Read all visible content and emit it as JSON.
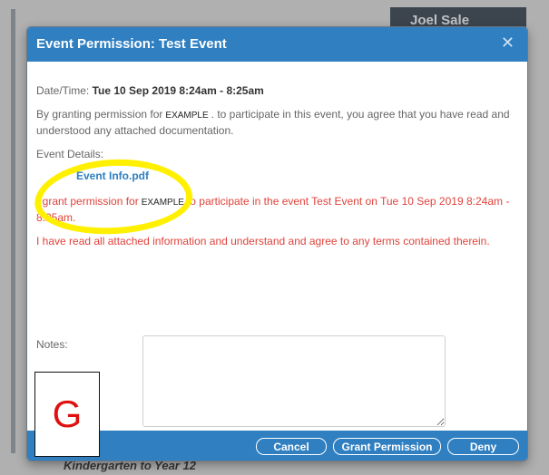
{
  "background": {
    "header_name": "Joel Sale",
    "bottom_text": "Kindergarten to Year 12"
  },
  "dialog": {
    "title": "Event Permission: Test Event",
    "close_icon": "close-icon",
    "datetime_label": "Date/Time:",
    "datetime_value": "Tue 10 Sep 2019 8:24am - 8:25am",
    "intro_part1": "By granting permission for",
    "intro_example": "EXAMPLE",
    "intro_part2": ". to participate in this event, you agree that you have read and understood any attached documentation.",
    "event_details_label": "Event Details:",
    "attachment_link": "Event Info.pdf",
    "grant_part1": "I grant permission for",
    "grant_example": "EXAMPLE",
    "grant_part2": "to participate in the event Test Event on Tue 10 Sep 2019 8:24am - 8:25am.",
    "terms_text": "I have read all attached information and understand and agree to any terms contained therein.",
    "notes_label": "Notes:",
    "notes_value": "",
    "buttons": {
      "cancel": "Cancel",
      "grant": "Grant Permission",
      "deny": "Deny"
    }
  },
  "overlay": {
    "letter": "G",
    "highlight_color": "#fff000",
    "letter_color": "#e01010"
  },
  "colors": {
    "accent": "#2f7fc1",
    "red_text": "#e0423b"
  }
}
